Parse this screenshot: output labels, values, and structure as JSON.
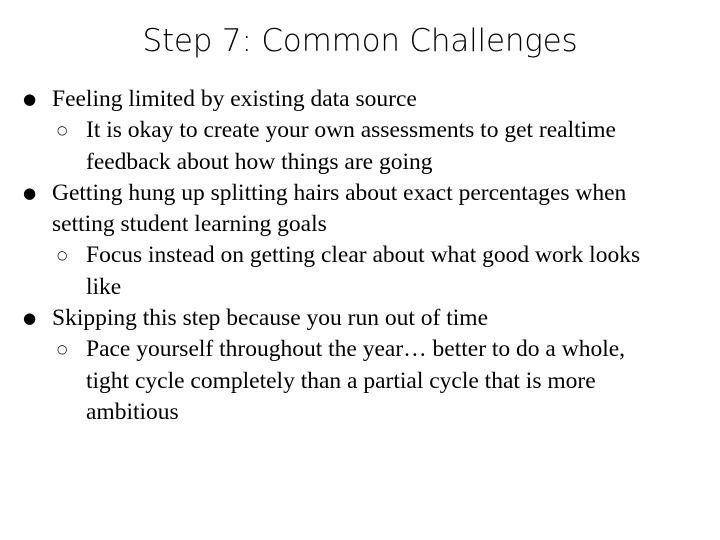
{
  "slide": {
    "title": "Step 7: Common Challenges",
    "background_color": "#ffffff",
    "text_color": "#000000",
    "bullet_level1_glyph": "●",
    "bullet_level2_glyph": "○",
    "bullets": [
      {
        "text": "Feeling limited by existing data source",
        "children": [
          {
            "text": "It is okay to create your own assessments to get realtime feedback about how things are going"
          }
        ]
      },
      {
        "text": "Getting hung up splitting hairs about exact percentages when setting student learning goals",
        "children": [
          {
            "text": "Focus instead on getting clear about what good work looks like"
          }
        ]
      },
      {
        "text": "Skipping this step because you run out of time",
        "children": [
          {
            "text": "Pace yourself throughout the year… better to do a whole, tight cycle completely than a partial cycle that is more ambitious"
          }
        ]
      }
    ]
  }
}
